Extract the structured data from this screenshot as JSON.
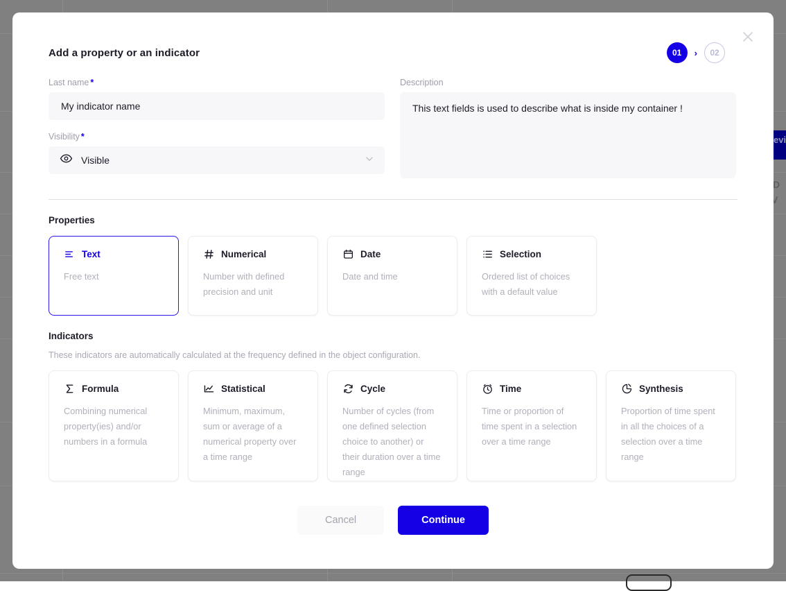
{
  "colors": {
    "accent": "#1500e6",
    "field_bg": "#f7f7f9",
    "muted_text": "#a9a9b4",
    "overlay": "#808080"
  },
  "modal": {
    "title": "Add a property or an indicator",
    "close_icon": "close-icon",
    "steps": [
      {
        "label": "01",
        "state": "active"
      },
      {
        "label": "02",
        "state": "inactive"
      }
    ],
    "step_separator": "›"
  },
  "form": {
    "name_field": {
      "label": "Last name",
      "required_marker": "*",
      "value": "My indicator name",
      "placeholder": "My indicator name"
    },
    "visibility_field": {
      "label": "Visibility",
      "required_marker": "*",
      "value": "Visible",
      "icon": "eye-icon",
      "chevron": "chevron-down-icon"
    },
    "description_field": {
      "label": "Description",
      "value": "This text fields is used to describe what is inside my container !",
      "placeholder": "This text fields is used to describe what is inside my container !"
    }
  },
  "properties": {
    "title": "Properties",
    "cards": [
      {
        "name": "text",
        "icon": "text-lines-icon",
        "title": "Text",
        "desc": "Free text",
        "selected": true
      },
      {
        "name": "numerical",
        "icon": "hash-icon",
        "title": "Numerical",
        "desc": "Number with defined precision and unit",
        "selected": false
      },
      {
        "name": "date",
        "icon": "calendar-icon",
        "title": "Date",
        "desc": "Date and time",
        "selected": false
      },
      {
        "name": "selection",
        "icon": "list-icon",
        "title": "Selection",
        "desc": "Ordered list of choices with a default value",
        "selected": false
      }
    ]
  },
  "indicators": {
    "title": "Indicators",
    "subtitle": "These indicators are automatically calculated at the frequency defined in the object configuration.",
    "cards": [
      {
        "name": "formula",
        "icon": "sigma-icon",
        "title": "Formula",
        "desc": "Combining numerical property(ies) and/or numbers in a formula",
        "selected": false
      },
      {
        "name": "statistical",
        "icon": "line-chart-icon",
        "title": "Statistical",
        "desc": "Minimum, maximum, sum or average of a numerical property over a time range",
        "selected": false
      },
      {
        "name": "cycle",
        "icon": "refresh-cycle-icon",
        "title": "Cycle",
        "desc": "Number of cycles (from one defined selection choice to another) or their duration over a time range",
        "selected": false
      },
      {
        "name": "time",
        "icon": "alarm-clock-icon",
        "title": "Time",
        "desc": "Time or proportion of time spent in a selection over a time range",
        "selected": false
      },
      {
        "name": "synthesis",
        "icon": "pie-chart-icon",
        "title": "Synthesis",
        "desc": "Proportion of time spent in all the choices of a selection over a time range",
        "selected": false
      }
    ]
  },
  "footer": {
    "cancel_label": "Cancel",
    "continue_label": "Continue"
  },
  "background": {
    "chip_label": "evi",
    "text_1": "D",
    "text_2": "V"
  }
}
